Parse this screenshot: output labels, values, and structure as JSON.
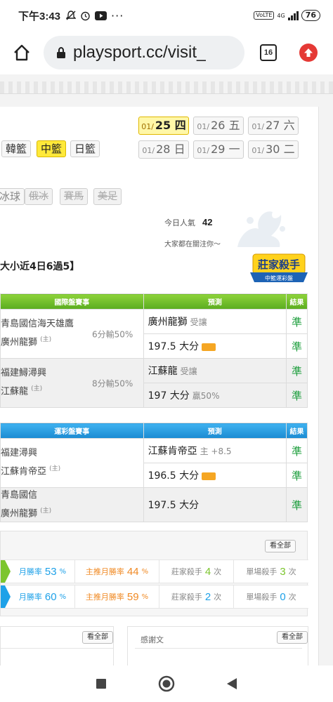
{
  "status": {
    "time": "下午3:43",
    "network": "4G",
    "volte": "VoLTE",
    "battery": "76"
  },
  "browser": {
    "url": "playsport.cc/visit_",
    "tab_count": "16"
  },
  "leagues": {
    "row1": [
      "韓籃",
      "中籃",
      "日籃"
    ],
    "active": "中籃",
    "row2": [
      "冰球",
      "俄冰",
      "賽馬",
      "美足"
    ]
  },
  "dates": [
    {
      "md": "01/",
      "day": "25",
      "wd": "四",
      "active": true
    },
    {
      "md": "01/",
      "day": "26",
      "wd": "五",
      "active": false
    },
    {
      "md": "01/",
      "day": "27",
      "wd": "六",
      "active": false
    },
    {
      "md": "01/",
      "day": "28",
      "wd": "日",
      "active": false
    },
    {
      "md": "01/",
      "day": "29",
      "wd": "一",
      "active": false
    },
    {
      "md": "01/",
      "day": "30",
      "wd": "二",
      "active": false
    }
  ],
  "popularity": {
    "label": "今日人氣",
    "value": "42",
    "sub": "大家都在關注你～"
  },
  "record_title": "大小近4日6過5】",
  "badge": {
    "title": "莊家殺手",
    "sub": "中籃運彩盤"
  },
  "intl_table": {
    "headers": [
      "國際盤賽事",
      "預測",
      "結果"
    ],
    "games": [
      {
        "team1": "青島國信海天雄鷹",
        "team2": "廣州龍獅",
        "home": "(主)",
        "handicap": "6分輸50%",
        "picks": [
          {
            "pick": "廣州龍獅",
            "note": "受讓",
            "result": "準"
          },
          {
            "pick": "197.5 大分",
            "note": "",
            "result": "準"
          }
        ]
      },
      {
        "team1": "福建鱘潯興",
        "team2": "江蘇龍",
        "home": "(主)",
        "handicap": "8分輸50%",
        "picks": [
          {
            "pick": "江蘇龍",
            "note": "受讓",
            "result": "準"
          },
          {
            "pick": "197 大分",
            "note": "贏50%",
            "result": "準"
          }
        ]
      }
    ]
  },
  "lottery_table": {
    "headers": [
      "運彩盤賽事",
      "預測",
      "結果"
    ],
    "games": [
      {
        "team1": "福建潯興",
        "team2": "江蘇肯帝亞",
        "home": "(主)",
        "picks": [
          {
            "pick": "江蘇肯帝亞",
            "note": "主 +8.5",
            "result": "準"
          },
          {
            "pick": "196.5 大分",
            "note": "",
            "result": "準"
          }
        ]
      },
      {
        "team1": "青島國信",
        "team2": "廣州龍獅",
        "home": "(主)",
        "picks": [
          {
            "pick": "197.5 大分",
            "note": "",
            "result": "準"
          }
        ]
      }
    ]
  },
  "stats": {
    "view_all": "看全部",
    "rows": [
      {
        "color": "#7cc52e",
        "win_label": "月勝率",
        "win": "53",
        "win_unit": "%",
        "main_label": "主推月勝率",
        "main": "44",
        "main_unit": "%",
        "killer_label": "莊家殺手",
        "killer": "4",
        "killer_unit": "次",
        "single_label": "單場殺手",
        "single": "3",
        "single_unit": "次"
      },
      {
        "color": "#1ea1e8",
        "win_label": "月勝率",
        "win": "60",
        "win_unit": "%",
        "main_label": "主推月勝率",
        "main": "59",
        "main_unit": "%",
        "killer_label": "莊家殺手",
        "killer": "2",
        "killer_unit": "次",
        "single_label": "單場殺手",
        "single": "0",
        "single_unit": "次"
      }
    ]
  },
  "panels": {
    "left_view_all": "看全部",
    "right_title": "感謝文",
    "right_view_all": "看全部"
  }
}
